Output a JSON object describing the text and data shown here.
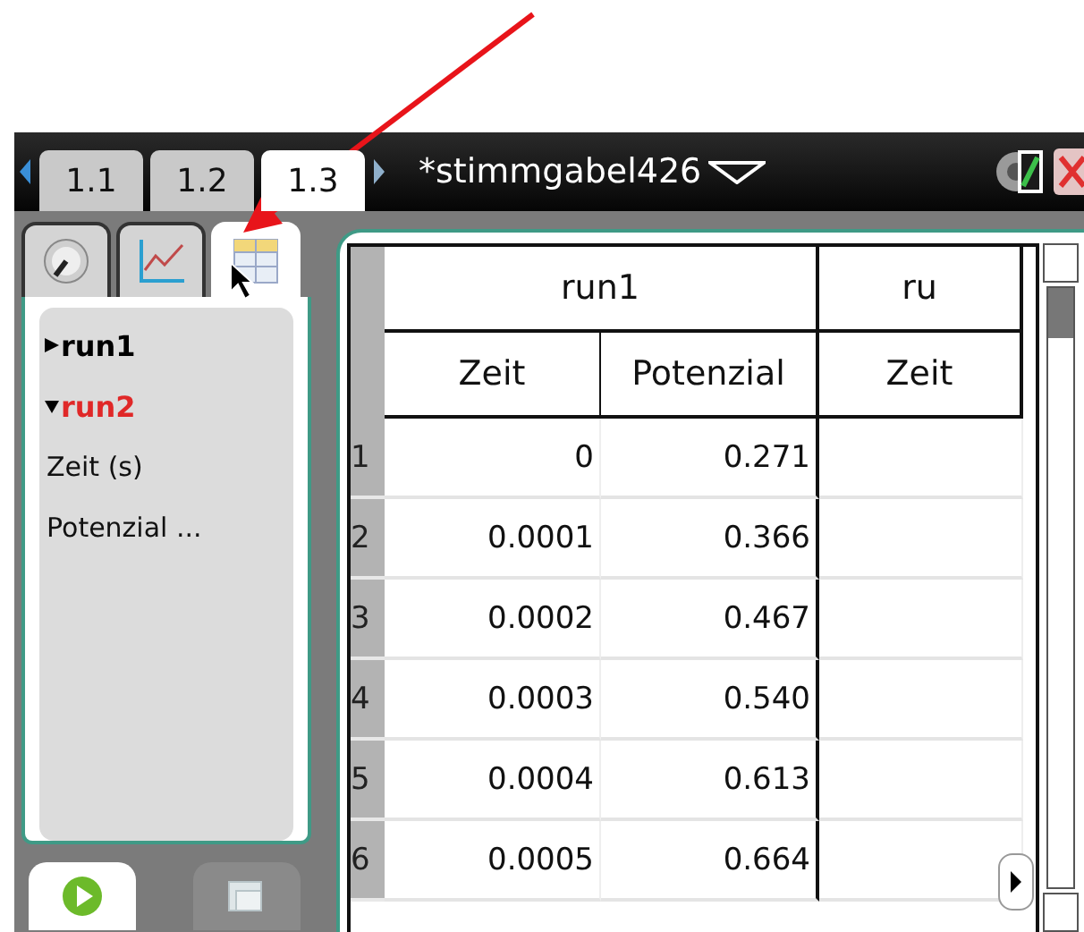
{
  "page_tabs": [
    {
      "label": "1.1",
      "selected": false
    },
    {
      "label": "1.2",
      "selected": false
    },
    {
      "label": "1.3",
      "selected": true
    }
  ],
  "document": {
    "title": "*stimmgabel426"
  },
  "view_tabs": [
    {
      "kind": "meter",
      "selected": false
    },
    {
      "kind": "graph",
      "selected": false
    },
    {
      "kind": "table",
      "selected": true
    }
  ],
  "data_sets": [
    {
      "label": "run1",
      "expanded": false,
      "selected": false
    },
    {
      "label": "run2",
      "expanded": true,
      "selected": true,
      "children": [
        {
          "label": "Zeit (s)"
        },
        {
          "label": "Potenzial ..."
        }
      ]
    }
  ],
  "table": {
    "groups": [
      {
        "label": "run1",
        "columns": [
          "Zeit",
          "Potenzial"
        ]
      },
      {
        "label": "ru",
        "columns": [
          "Zeit"
        ]
      }
    ],
    "rows": [
      {
        "index": "1",
        "cells": [
          "0",
          "0.271",
          ""
        ]
      },
      {
        "index": "2",
        "cells": [
          "0.0001",
          "0.366",
          ""
        ]
      },
      {
        "index": "3",
        "cells": [
          "0.0002",
          "0.467",
          ""
        ]
      },
      {
        "index": "4",
        "cells": [
          "0.0003",
          "0.540",
          ""
        ]
      },
      {
        "index": "5",
        "cells": [
          "0.0004",
          "0.613",
          ""
        ]
      },
      {
        "index": "6",
        "cells": [
          "0.0005",
          "0.664",
          ""
        ]
      }
    ]
  }
}
